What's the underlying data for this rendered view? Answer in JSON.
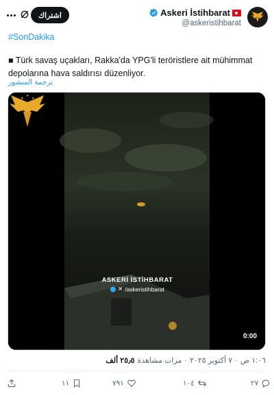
{
  "author": {
    "display_name": "Askeri İstihbarat",
    "handle": "@askeristihbarat",
    "avatar_icon": "eagle-logo-icon",
    "verified_icon": "verified-badge-icon",
    "flag_icon": "turkey-flag-icon"
  },
  "header": {
    "subscribe_label": "اشتراك",
    "grok_icon": "grok-icon",
    "more_icon": "more-icon"
  },
  "post": {
    "hashtag": "#SonDakika",
    "text": "■ Türk savaş uçakları, Rakka'da YPG'li teröristlere ait mühimmat depolarına hava saldırısı düzenliyor.",
    "translate_label": "ترجمة المنشور"
  },
  "video": {
    "watermark_title": "ASKERİ İSTİHBARAT",
    "watermark_handle": "/askeristihbarat",
    "duration": "0:00"
  },
  "meta": {
    "time": "١:٠٦ ص",
    "separator": "·",
    "date": "٧ أكتوبر ٢٠٢٥",
    "separator2": "·",
    "views_count": "٢٥٫٥ ألف",
    "views_label": "مرات مشاهدة"
  },
  "actions": {
    "replies": "٢٧",
    "reposts": "١٠٤",
    "likes": "٧٩١",
    "bookmarks": "١١"
  },
  "colors": {
    "accent": "#1d9bf0",
    "text": "#0f1419",
    "secondary": "#536471",
    "gold": "#e9a92a"
  }
}
